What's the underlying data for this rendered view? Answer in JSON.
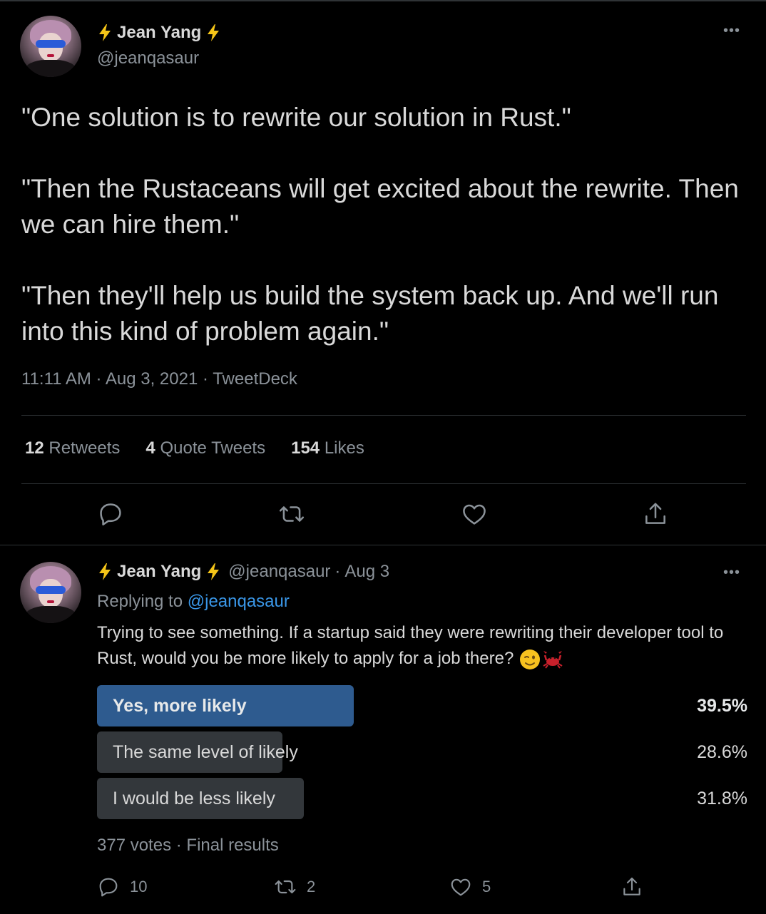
{
  "colors": {
    "background": "#000000",
    "text": "#d9d9d9",
    "muted": "#8b9299",
    "link": "#3a97e8",
    "poll_winner": "#2e5b8f",
    "poll_other": "#33373b",
    "divider": "#2f3336",
    "bolt": "#f5c518"
  },
  "tweet": {
    "display_name": "Jean Yang",
    "handle": "@jeanqasaur",
    "more_icon": "more-horizontal-icon",
    "paragraphs": [
      "\"One solution is to rewrite our solution in Rust.\"",
      "\"Then the Rustaceans will get excited about the rewrite. Then we can hire them.\"",
      "\"Then they'll help us build the system back up. And we'll run into this kind of problem again.\""
    ],
    "time": "11:11 AM",
    "date": "Aug 3, 2021",
    "source": "TweetDeck",
    "stats": {
      "retweets_count": "12",
      "retweets_label": "Retweets",
      "quotes_count": "4",
      "quotes_label": "Quote Tweets",
      "likes_count": "154",
      "likes_label": "Likes"
    },
    "actions": [
      "reply-icon",
      "retweet-icon",
      "like-icon",
      "share-icon"
    ]
  },
  "reply": {
    "display_name": "Jean Yang",
    "handle": "@jeanqasaur",
    "date": "Aug 3",
    "replying_prefix": "Replying to",
    "replying_to": "@jeanqasaur",
    "text": "Trying to see something. If a startup said they were rewriting their developer tool to Rust, would you be more likely to apply for a job there?",
    "emojis": [
      "winking-face-emoji",
      "crab-emoji"
    ],
    "poll": {
      "options": [
        {
          "label": "Yes, more likely",
          "percent_label": "39.5%",
          "percent": 39.5,
          "winner": true
        },
        {
          "label": "The same level of likely",
          "percent_label": "28.6%",
          "percent": 28.6,
          "winner": false
        },
        {
          "label": "I would be less likely",
          "percent_label": "31.8%",
          "percent": 31.8,
          "winner": false
        }
      ],
      "votes": "377 votes",
      "status": "Final results"
    },
    "actions": {
      "replies": "10",
      "retweets": "2",
      "likes": "5"
    }
  }
}
